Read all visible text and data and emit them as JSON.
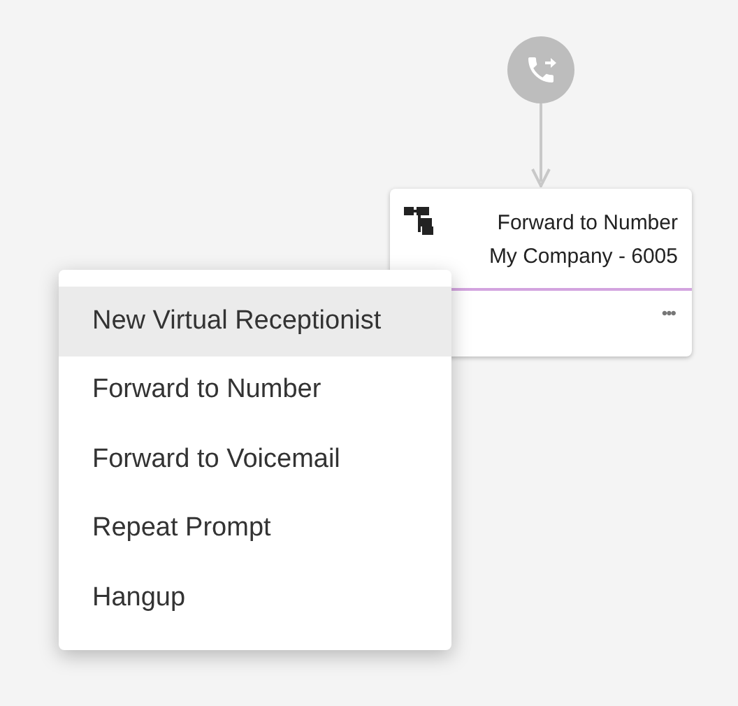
{
  "node": {
    "title": "Forward to Number",
    "subtitle": "My Company - 6005",
    "more": "•••"
  },
  "menu": {
    "items": [
      {
        "label": "New Virtual Receptionist",
        "selected": true
      },
      {
        "label": "Forward to Number",
        "selected": false
      },
      {
        "label": "Forward to Voicemail",
        "selected": false
      },
      {
        "label": "Repeat Prompt",
        "selected": false
      },
      {
        "label": "Hangup",
        "selected": false
      }
    ]
  }
}
